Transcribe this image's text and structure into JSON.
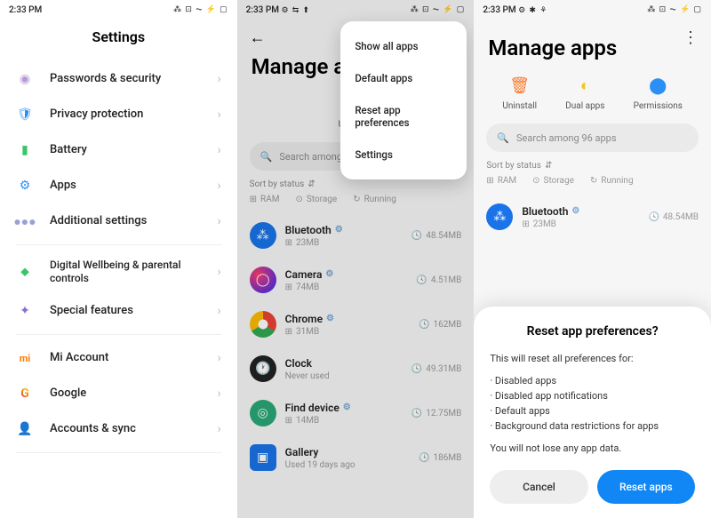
{
  "status": {
    "time": "2:33 PM",
    "icons_left": "⚙ ⬆",
    "icons_left2": "⚙ ⇆ ⬆",
    "icons_left3": "⚙ ✱ ⚘",
    "icons_right": "⁂ ⊡ ⏦ ⚡ ▢"
  },
  "panel1": {
    "title": "Settings",
    "items": [
      {
        "icon": "◉",
        "color": "#b89bd4",
        "label": "Passwords & security"
      },
      {
        "icon": "🛡",
        "color": "#2b8ff5",
        "label": "Privacy protection"
      },
      {
        "icon": "▮",
        "color": "#3ac569",
        "label": "Battery"
      },
      {
        "icon": "⚙",
        "color": "#2b8ff5",
        "label": "Apps"
      },
      {
        "icon": "●",
        "color": "#9aa0d6",
        "label": "Additional settings"
      }
    ],
    "items2": [
      {
        "icon": "♥",
        "color": "#3ac569",
        "label": "Digital Wellbeing & parental controls"
      },
      {
        "icon": "✦",
        "color": "#8a6bd6",
        "label": "Special features"
      }
    ],
    "items3": [
      {
        "icon": "mi",
        "color": "#ff7a00",
        "label": "Mi Account",
        "mi": true
      },
      {
        "icon": "G",
        "color": "#4285f4",
        "label": "Google",
        "g": true
      },
      {
        "icon": "👤",
        "color": "#2b8ff5",
        "label": "Accounts & sync"
      }
    ]
  },
  "panel2": {
    "title": "Manage a",
    "title_full": "Manage apps",
    "actions": {
      "uninstall": "Uninstall",
      "dual": "Dual apps",
      "perm": "Permissions"
    },
    "search_placeholder": "Search among 96 apps",
    "sort": "Sort by status",
    "chips": {
      "ram": "RAM",
      "storage": "Storage",
      "running": "Running"
    },
    "menu": [
      "Show all apps",
      "Default apps",
      "Reset app preferences",
      "Settings"
    ],
    "apps": [
      {
        "name": "Bluetooth",
        "ram": "23MB",
        "size": "48.54MB"
      },
      {
        "name": "Camera",
        "ram": "74MB",
        "size": "4.51MB"
      },
      {
        "name": "Chrome",
        "ram": "31MB",
        "size": "162MB"
      },
      {
        "name": "Clock",
        "sub": "Never used",
        "size": "49.31MB"
      },
      {
        "name": "Find device",
        "ram": "14MB",
        "size": "12.75MB"
      },
      {
        "name": "Gallery",
        "sub": "Used 19 days ago",
        "size": "186MB"
      }
    ]
  },
  "panel3": {
    "sheet": {
      "title": "Reset app preferences?",
      "intro": "This will reset all preferences for:",
      "bullets": [
        "Disabled apps",
        "Disabled app notifications",
        "Default apps",
        "Background data restrictions for apps"
      ],
      "outro": "You will not lose any app data.",
      "cancel": "Cancel",
      "reset": "Reset apps"
    }
  }
}
